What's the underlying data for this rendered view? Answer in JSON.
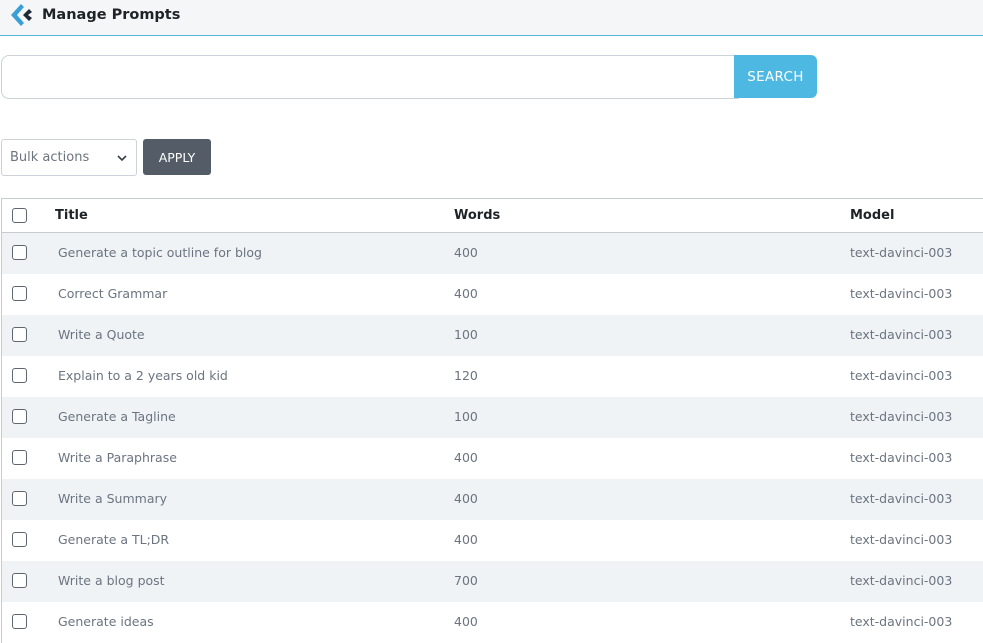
{
  "header": {
    "title": "Manage Prompts",
    "logo_icon": "double-chevron-left-logo"
  },
  "search": {
    "value": "",
    "placeholder": "",
    "button_label": "SEARCH"
  },
  "bulk": {
    "selected": "Bulk actions",
    "apply_label": "APPLY"
  },
  "table": {
    "columns": [
      "Title",
      "Words",
      "Model"
    ],
    "rows": [
      {
        "title": "Generate a topic outline for blog",
        "words": "400",
        "model": "text-davinci-003"
      },
      {
        "title": "Correct Grammar",
        "words": "400",
        "model": "text-davinci-003"
      },
      {
        "title": "Write a Quote",
        "words": "100",
        "model": "text-davinci-003"
      },
      {
        "title": "Explain to a 2 years old kid",
        "words": "120",
        "model": "text-davinci-003"
      },
      {
        "title": "Generate a Tagline",
        "words": "100",
        "model": "text-davinci-003"
      },
      {
        "title": "Write a Paraphrase",
        "words": "400",
        "model": "text-davinci-003"
      },
      {
        "title": "Write a Summary",
        "words": "400",
        "model": "text-davinci-003"
      },
      {
        "title": "Generate a TL;DR",
        "words": "400",
        "model": "text-davinci-003"
      },
      {
        "title": "Write a blog post",
        "words": "700",
        "model": "text-davinci-003"
      },
      {
        "title": "Generate ideas",
        "words": "400",
        "model": "text-davinci-003"
      }
    ]
  },
  "colors": {
    "accent": "#4db8e2",
    "apply_bg": "#535c67",
    "header_border": "#56b6d6",
    "row_alt": "#f0f3f6"
  }
}
